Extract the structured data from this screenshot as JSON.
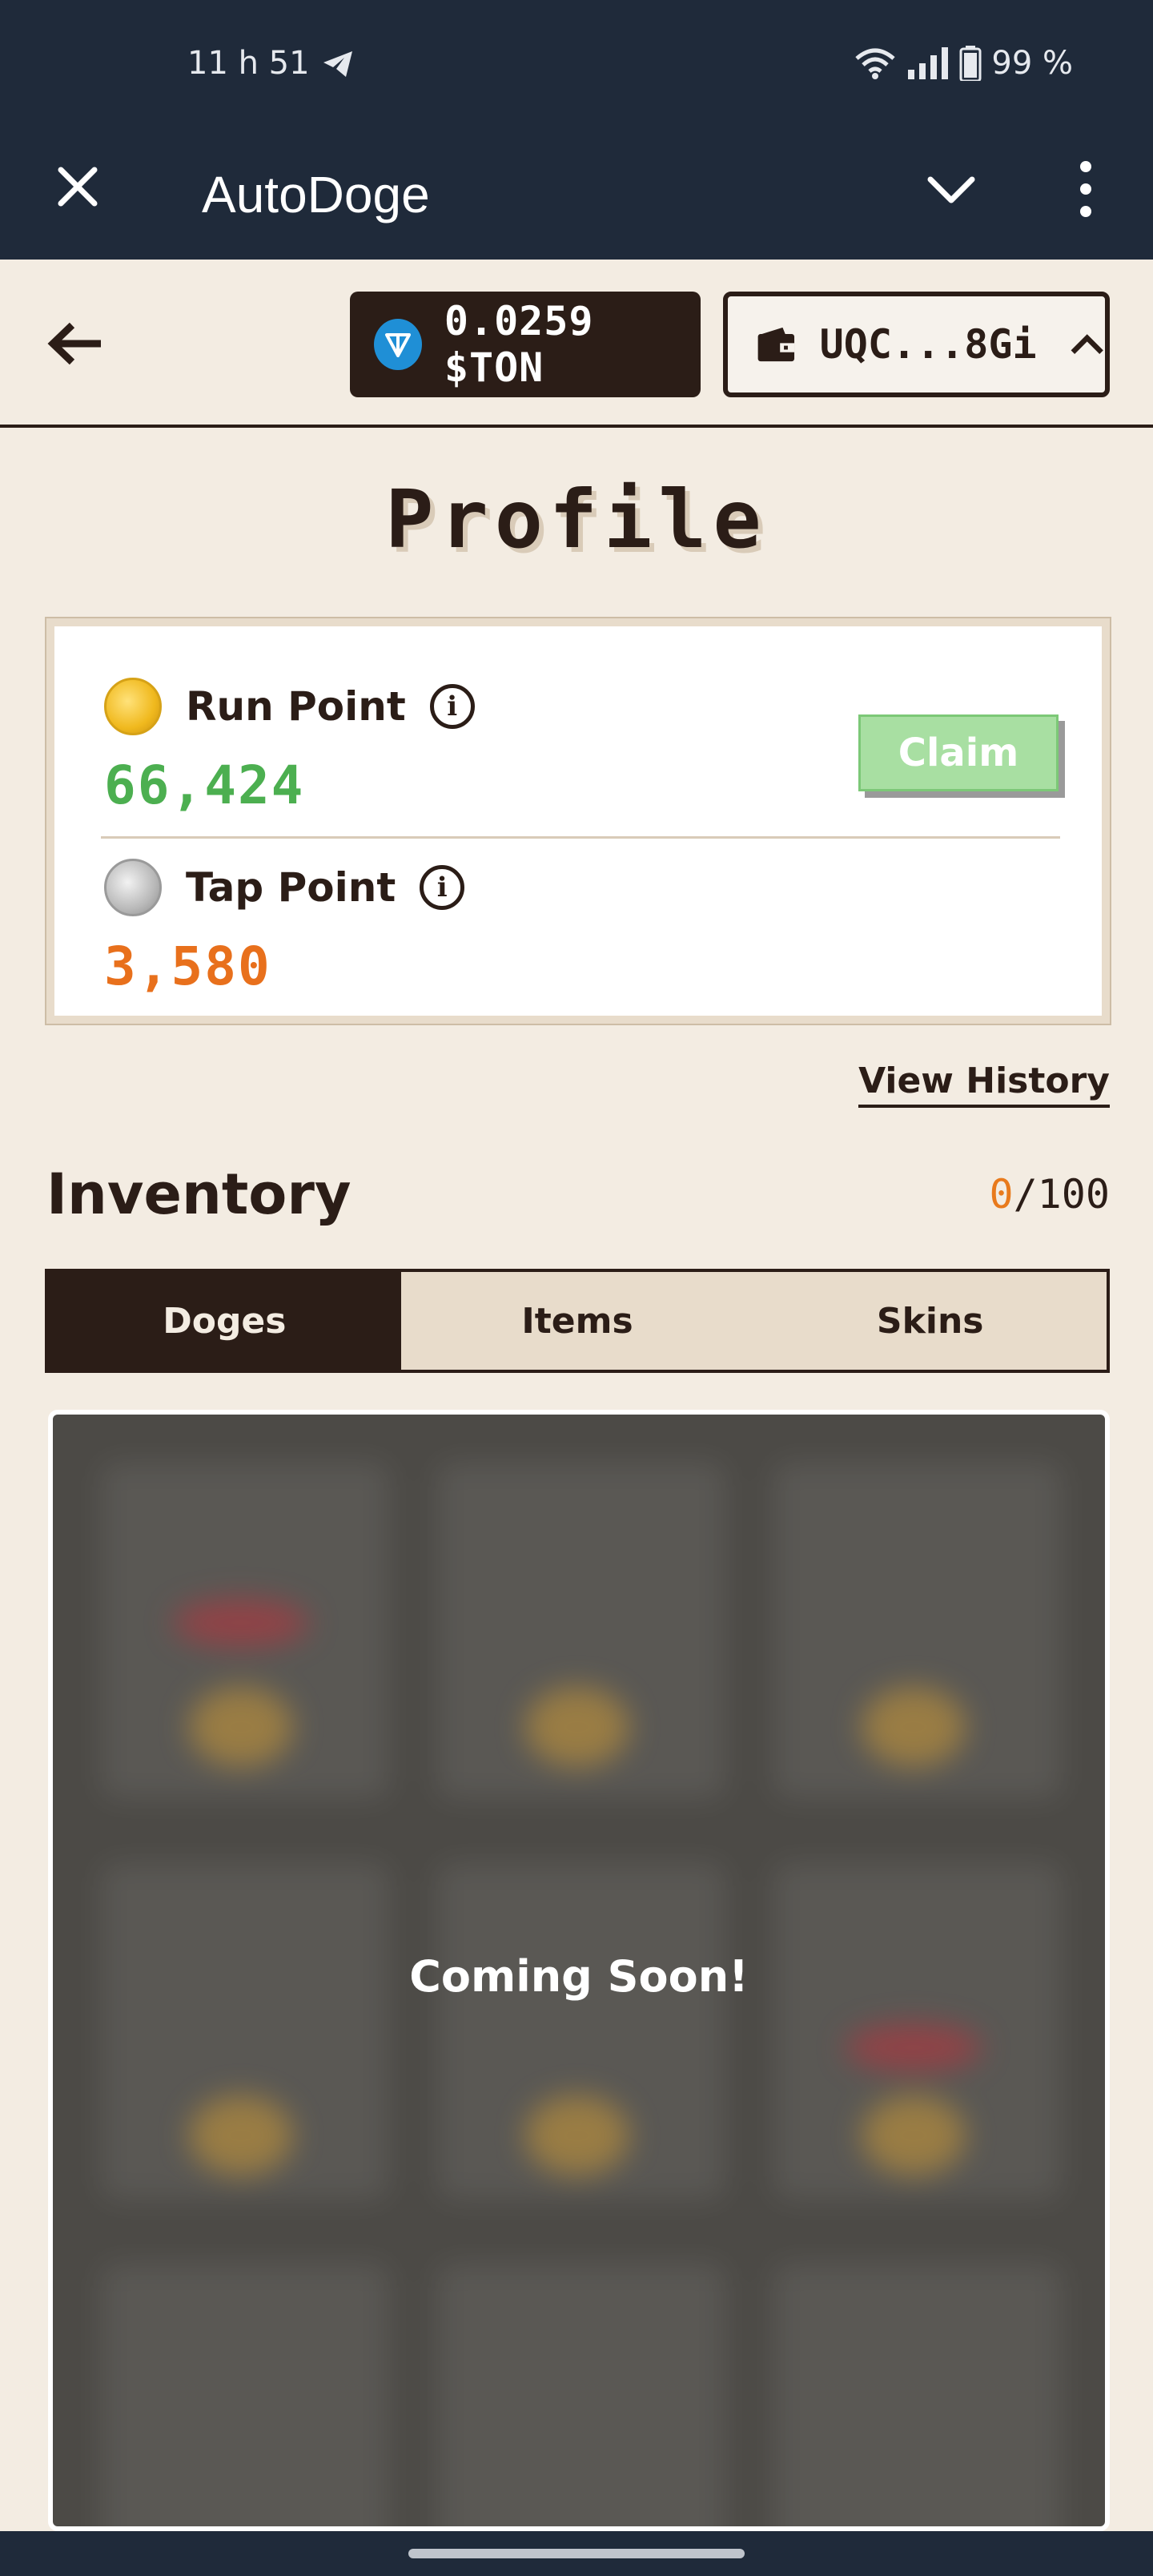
{
  "status_bar": {
    "time": "11 h 51",
    "battery": "99 %"
  },
  "app_bar": {
    "title": "AutoDoge"
  },
  "wallet": {
    "ton_balance": "0.0259 $TON",
    "address": "UQC...8Gi"
  },
  "page": {
    "title": "Profile"
  },
  "points": {
    "run": {
      "label": "Run Point",
      "value": "66,424",
      "claim_label": "Claim"
    },
    "tap": {
      "label": "Tap Point",
      "value": "3,580"
    }
  },
  "colors": {
    "run_value": "#4caf50",
    "tap_value": "#e8701c",
    "dark": "#2b1d17"
  },
  "view_history": "View History",
  "inventory": {
    "title": "Inventory",
    "used": "0",
    "capacity": "/100",
    "tabs": [
      {
        "label": "Doges",
        "active": true
      },
      {
        "label": "Items",
        "active": false
      },
      {
        "label": "Skins",
        "active": false
      }
    ],
    "overlay_text": "Coming Soon!"
  },
  "icons": {
    "close": "close-icon",
    "dropdown": "chevron-down-icon",
    "menu": "more-vertical-icon",
    "back": "arrow-left-icon",
    "ton": "ton-logo-icon",
    "wallet": "wallet-icon",
    "caret": "chevron-up-icon",
    "info": "info-icon"
  }
}
